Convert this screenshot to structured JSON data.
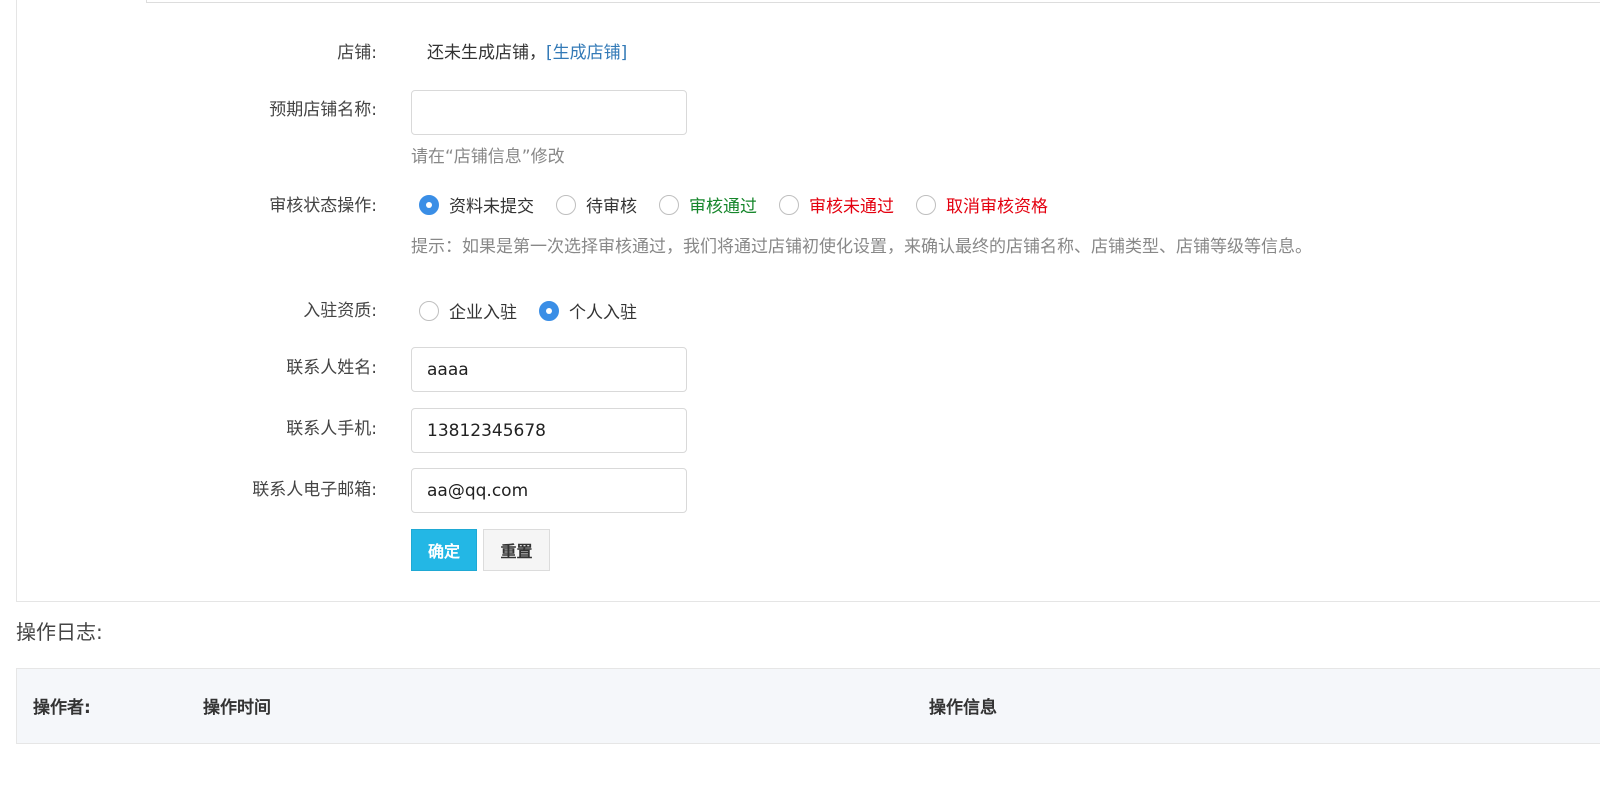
{
  "form": {
    "shop": {
      "label": "店铺:",
      "status_text": "还未生成店铺，",
      "generate_link": "[生成店铺]"
    },
    "expected_name": {
      "label": "预期店铺名称:",
      "value": "",
      "help": "请在“店铺信息”修改"
    },
    "audit": {
      "label": "审核状态操作:",
      "options": [
        {
          "label": "资料未提交",
          "checked": true,
          "color": "#333333"
        },
        {
          "label": "待审核",
          "checked": false,
          "color": "#333333"
        },
        {
          "label": "审核通过",
          "checked": false,
          "color": "#16862b"
        },
        {
          "label": "审核未通过",
          "checked": false,
          "color": "#e4000f"
        },
        {
          "label": "取消审核资格",
          "checked": false,
          "color": "#e4000f"
        }
      ],
      "tip": "提示：如果是第一次选择审核通过，我们将通过店铺初使化设置，来确认最终的店铺名称、店铺类型、店铺等级等信息。"
    },
    "qualification": {
      "label": "入驻资质:",
      "options": [
        {
          "label": "企业入驻",
          "checked": false
        },
        {
          "label": "个人入驻",
          "checked": true
        }
      ]
    },
    "contact_name": {
      "label": "联系人姓名:",
      "value": "aaaa"
    },
    "contact_phone": {
      "label": "联系人手机:",
      "value": "13812345678"
    },
    "contact_email": {
      "label": "联系人电子邮箱:",
      "value": "aa@qq.com"
    },
    "buttons": {
      "confirm": "确定",
      "reset": "重置"
    }
  },
  "log": {
    "title": "操作日志:",
    "columns": [
      "操作者:",
      "操作时间",
      "操作信息"
    ]
  },
  "colors": {
    "primary": "#23b7e5",
    "link": "#337ab7",
    "radio_checked": "#3a8ee6",
    "success": "#16862b",
    "danger": "#e4000f"
  }
}
